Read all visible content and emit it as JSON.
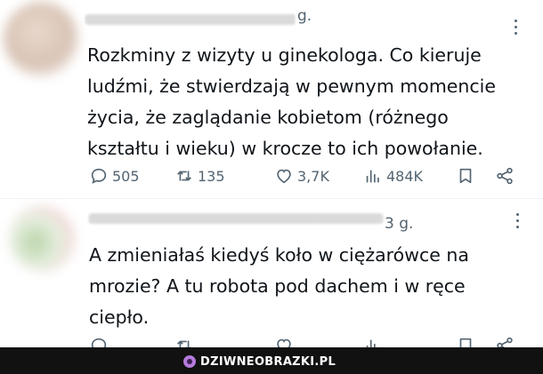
{
  "tweets": [
    {
      "time": "g.",
      "text": "Rozkminy z wizyty u ginekologa. Co kieruje\nludźmi, że stwierdzają w pewnym momencie\nżycia, że zaglądanie kobietom (różnego\nkształtu i wieku) w krocze to ich powołanie.",
      "replies": "505",
      "retweets": "135",
      "likes": "3,7K",
      "views": "484K"
    },
    {
      "time": "3 g.",
      "text": "A zmieniałaś kiedyś koło w ciężarówce na\nmrozie? A tu robota pod dachem i w ręce\nciepło.",
      "replies": "",
      "retweets": "",
      "likes": "",
      "views": ""
    }
  ],
  "colors": {
    "text": "#0f1419",
    "muted": "#536471",
    "bar": "#111111",
    "brand_icon": "#b47adb"
  },
  "watermark": {
    "text": "DZIWNEOBRAZKI.PL"
  }
}
